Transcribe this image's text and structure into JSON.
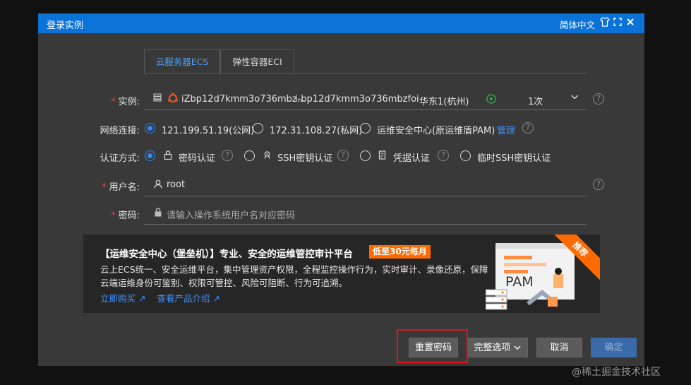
{
  "window": {
    "title": "登录实例",
    "language": "简体中文"
  },
  "tabs": [
    {
      "label": "云服务器ECS",
      "active": true
    },
    {
      "label": "弹性容器ECI",
      "active": false
    }
  ],
  "instance": {
    "label": "实例:",
    "name": "iZbp12d7kmm3o736mbz...",
    "id": "i-bp12d7kmm3o736mbzfoi",
    "region": "华东1(杭州)",
    "count": "1次"
  },
  "network": {
    "label": "网络连接:",
    "options": [
      {
        "label": "121.199.51.19(公网)",
        "selected": true
      },
      {
        "label": "172.31.108.27(私网)",
        "selected": false
      },
      {
        "label": "运维安全中心(原运维盾PAM)",
        "selected": false
      }
    ],
    "manage_link": "管理"
  },
  "auth": {
    "label": "认证方式:",
    "options": [
      {
        "label": "密码认证",
        "selected": true
      },
      {
        "label": "SSH密钥认证",
        "selected": false
      },
      {
        "label": "凭据认证",
        "selected": false
      },
      {
        "label": "临时SSH密钥认证",
        "selected": false
      }
    ]
  },
  "username": {
    "label": "用户名:",
    "value": "root"
  },
  "password": {
    "label": "密码:",
    "placeholder": "请输入操作系统用户名对应密码"
  },
  "banner": {
    "title": "【运维安全中心（堡垒机）】专业、安全的运维管控审计平台",
    "badge": "低至30元每月",
    "desc": "云上ECS统一、安全运维平台，集中管理资产权限，全程监控操作行为，实时审计、录像还原，保障云端运维身份可鉴别、权限可管控、风险可阻断、行为可追溯。",
    "buy_link": "立即购买",
    "intro_link": "查看产品介绍",
    "ribbon": "推荐",
    "pam_text": "PAM"
  },
  "buttons": {
    "reset_password": "重置密码",
    "full_options": "完整选项",
    "cancel": "取消",
    "confirm": "确定"
  },
  "watermark": "@稀土掘金技术社区",
  "colors": {
    "titlebar": "#0b73d8",
    "accent": "#2a8cff",
    "badge": "#ff6a00",
    "highlight": "#e0141c"
  }
}
